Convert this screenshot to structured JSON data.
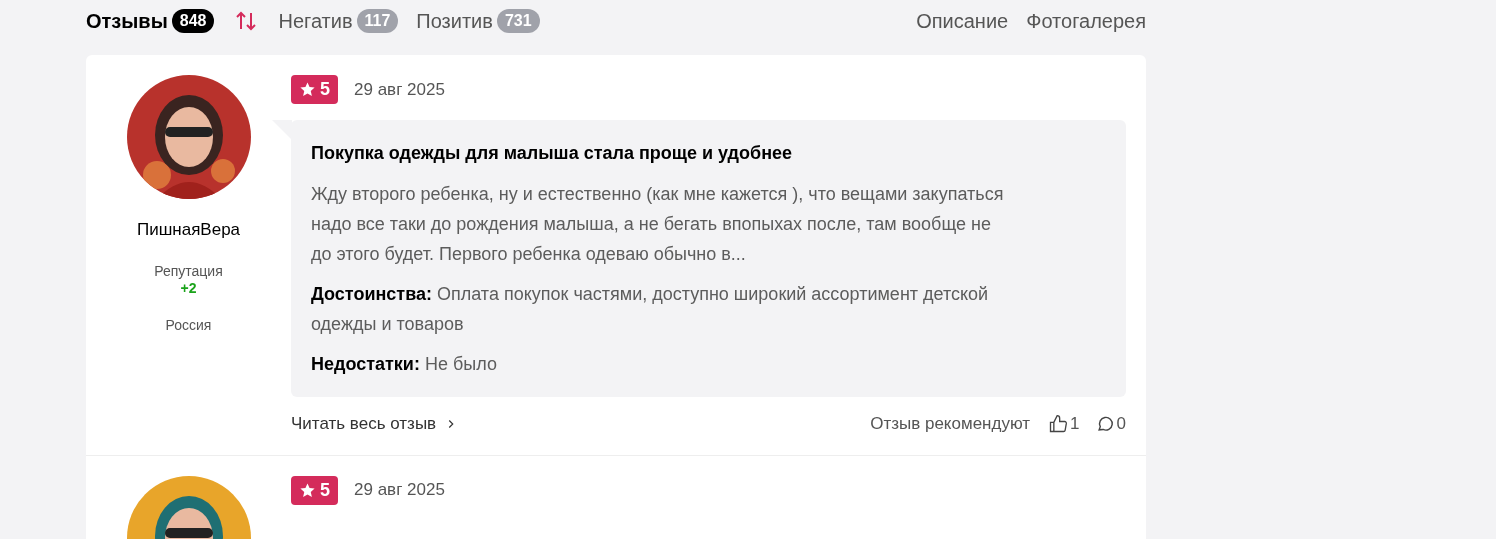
{
  "tabs": [
    {
      "label": "Отзывы",
      "count": "848",
      "selected": true
    },
    {
      "label": "Негатив",
      "count": "117",
      "selected": false
    },
    {
      "label": "Позитив",
      "count": "731",
      "selected": false
    }
  ],
  "links": [
    "Описание",
    "Фотогалерея"
  ],
  "reviews": [
    {
      "author": "ПишнаяВера",
      "reputation_label": "Репутация",
      "reputation": "+2",
      "country": "Россия",
      "rating": "5",
      "date": "29 авг 2025",
      "title": "Покупка одежды для малыша стала проще и удобнее",
      "text": "Жду второго ребенка, ну и естественно (как мне кажется ), что вещами закупаться надо все таки до рождения малыша, а не бегать впопыхах после, там вообще не до этого будет. Первого ребенка одеваю обычно в...",
      "pros_label": "Достоинства:",
      "pros": "Оплата покупок частями, доступно широкий ассортимент детской одежды и товаров",
      "cons_label": "Недостатки:",
      "cons": "Не было",
      "read_more": "Читать весь отзыв",
      "recommend_label": "Отзыв рекомендуют",
      "likes": "1",
      "comments": "0"
    },
    {
      "rating": "5",
      "date": "29 авг 2025"
    }
  ]
}
